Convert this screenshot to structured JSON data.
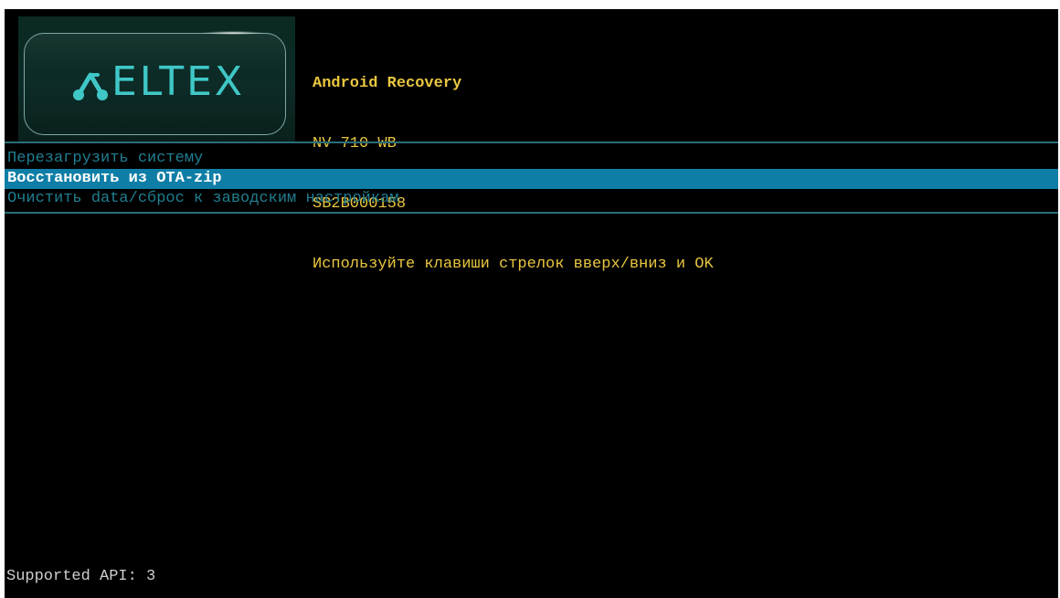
{
  "logo": {
    "brand_text": "ELTEX",
    "brand_color": "#3fc7c6"
  },
  "header": {
    "title": "Android Recovery",
    "model": "NV-710-WB",
    "serial": "SB2B000158",
    "hint": "Используйте клавиши стрелок вверх/вниз и OK",
    "text_color": "#e8c640"
  },
  "menu": {
    "items": [
      {
        "label": "Перезагрузить систему",
        "selected": false
      },
      {
        "label": "Восстановить из OTA-zip",
        "selected": true
      },
      {
        "label": "Очистить data/сброс к заводским настройкам",
        "selected": false
      }
    ],
    "item_color": "#1f7f92",
    "selected_bg": "#0f7ea6"
  },
  "footer": {
    "api_text": "Supported API: 3"
  }
}
